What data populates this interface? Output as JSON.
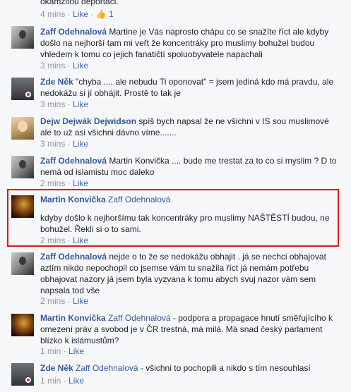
{
  "top": {
    "text": "okamžitou deportaci.",
    "time": "4 mins",
    "like": "Like",
    "likes_count": "1"
  },
  "comments": [
    {
      "author": "Zaff Odehnalová",
      "body": "Martine je Vás naprosto chápu co se snažíte říct ale kdyby došlo na nejhorší tam mi veřt že koncentráky pro muslimy bohužel budou vhledem k tomu co jejich fanatičtí spoluobyvatele napachali",
      "time": "3 mins",
      "like": "Like"
    },
    {
      "author": "Zde Něk",
      "body": "\"chyba .... ale nebudu Ti oponovat\" = jsem jediná kdo má pravdu, ale nedokážu si jí obhájit. Prostě to tak je",
      "time": "3 mins",
      "like": "Like"
    },
    {
      "author": "Dejw Dejwák Dejwidson",
      "body": "spíš bych napsal že ne všichni v IS sou muslimové ale to už asi všichni dávno víme.......",
      "time": "3 mins",
      "like": "Like"
    },
    {
      "author": "Zaff Odehnalová",
      "body": "Martin Konvička .... bude me trestat za to co si myslim ? D to nemá od islamistu moc daleko",
      "time": "2 mins",
      "like": "Like"
    },
    {
      "author": "Martin Konvička",
      "tag": "Zaff Odehnalová",
      "body": "kdyby došlo k nejhoršímu tak koncentráky pro muslimy NAŠTĚSTÍ budou, ne bohužel. Řekli si o to sami.",
      "time": "2 mins",
      "like": "Like"
    },
    {
      "author": "Zaff Odehnalová",
      "body": "nejde o to že se nedokážu obhajit . já se nechci obhajovat aztím nikdo nepochopil co jsemse vám tu snažila říct já nemám potřebu obhajovat nazory já jsem byla vyzvana k tomu abych svuj nazor vám sem napsala tod vše",
      "time": "2 mins",
      "like": "Like"
    },
    {
      "author": "Martin Konvička",
      "tag": "Zaff Odehnalová",
      "body": "- podpora a propagace hnutí směřujícího k omezení práv a svobod je v ČR trestná, má milá. Má snad český parlament blízko k islámustům?",
      "time": "1 min",
      "like": "Like"
    },
    {
      "author": "Zde Něk",
      "tag": "Zaff Odehnalová",
      "body": "- všichni to pochopili a nikdo s tím nesouhlasí",
      "time": "1 min",
      "like": "Like"
    }
  ]
}
